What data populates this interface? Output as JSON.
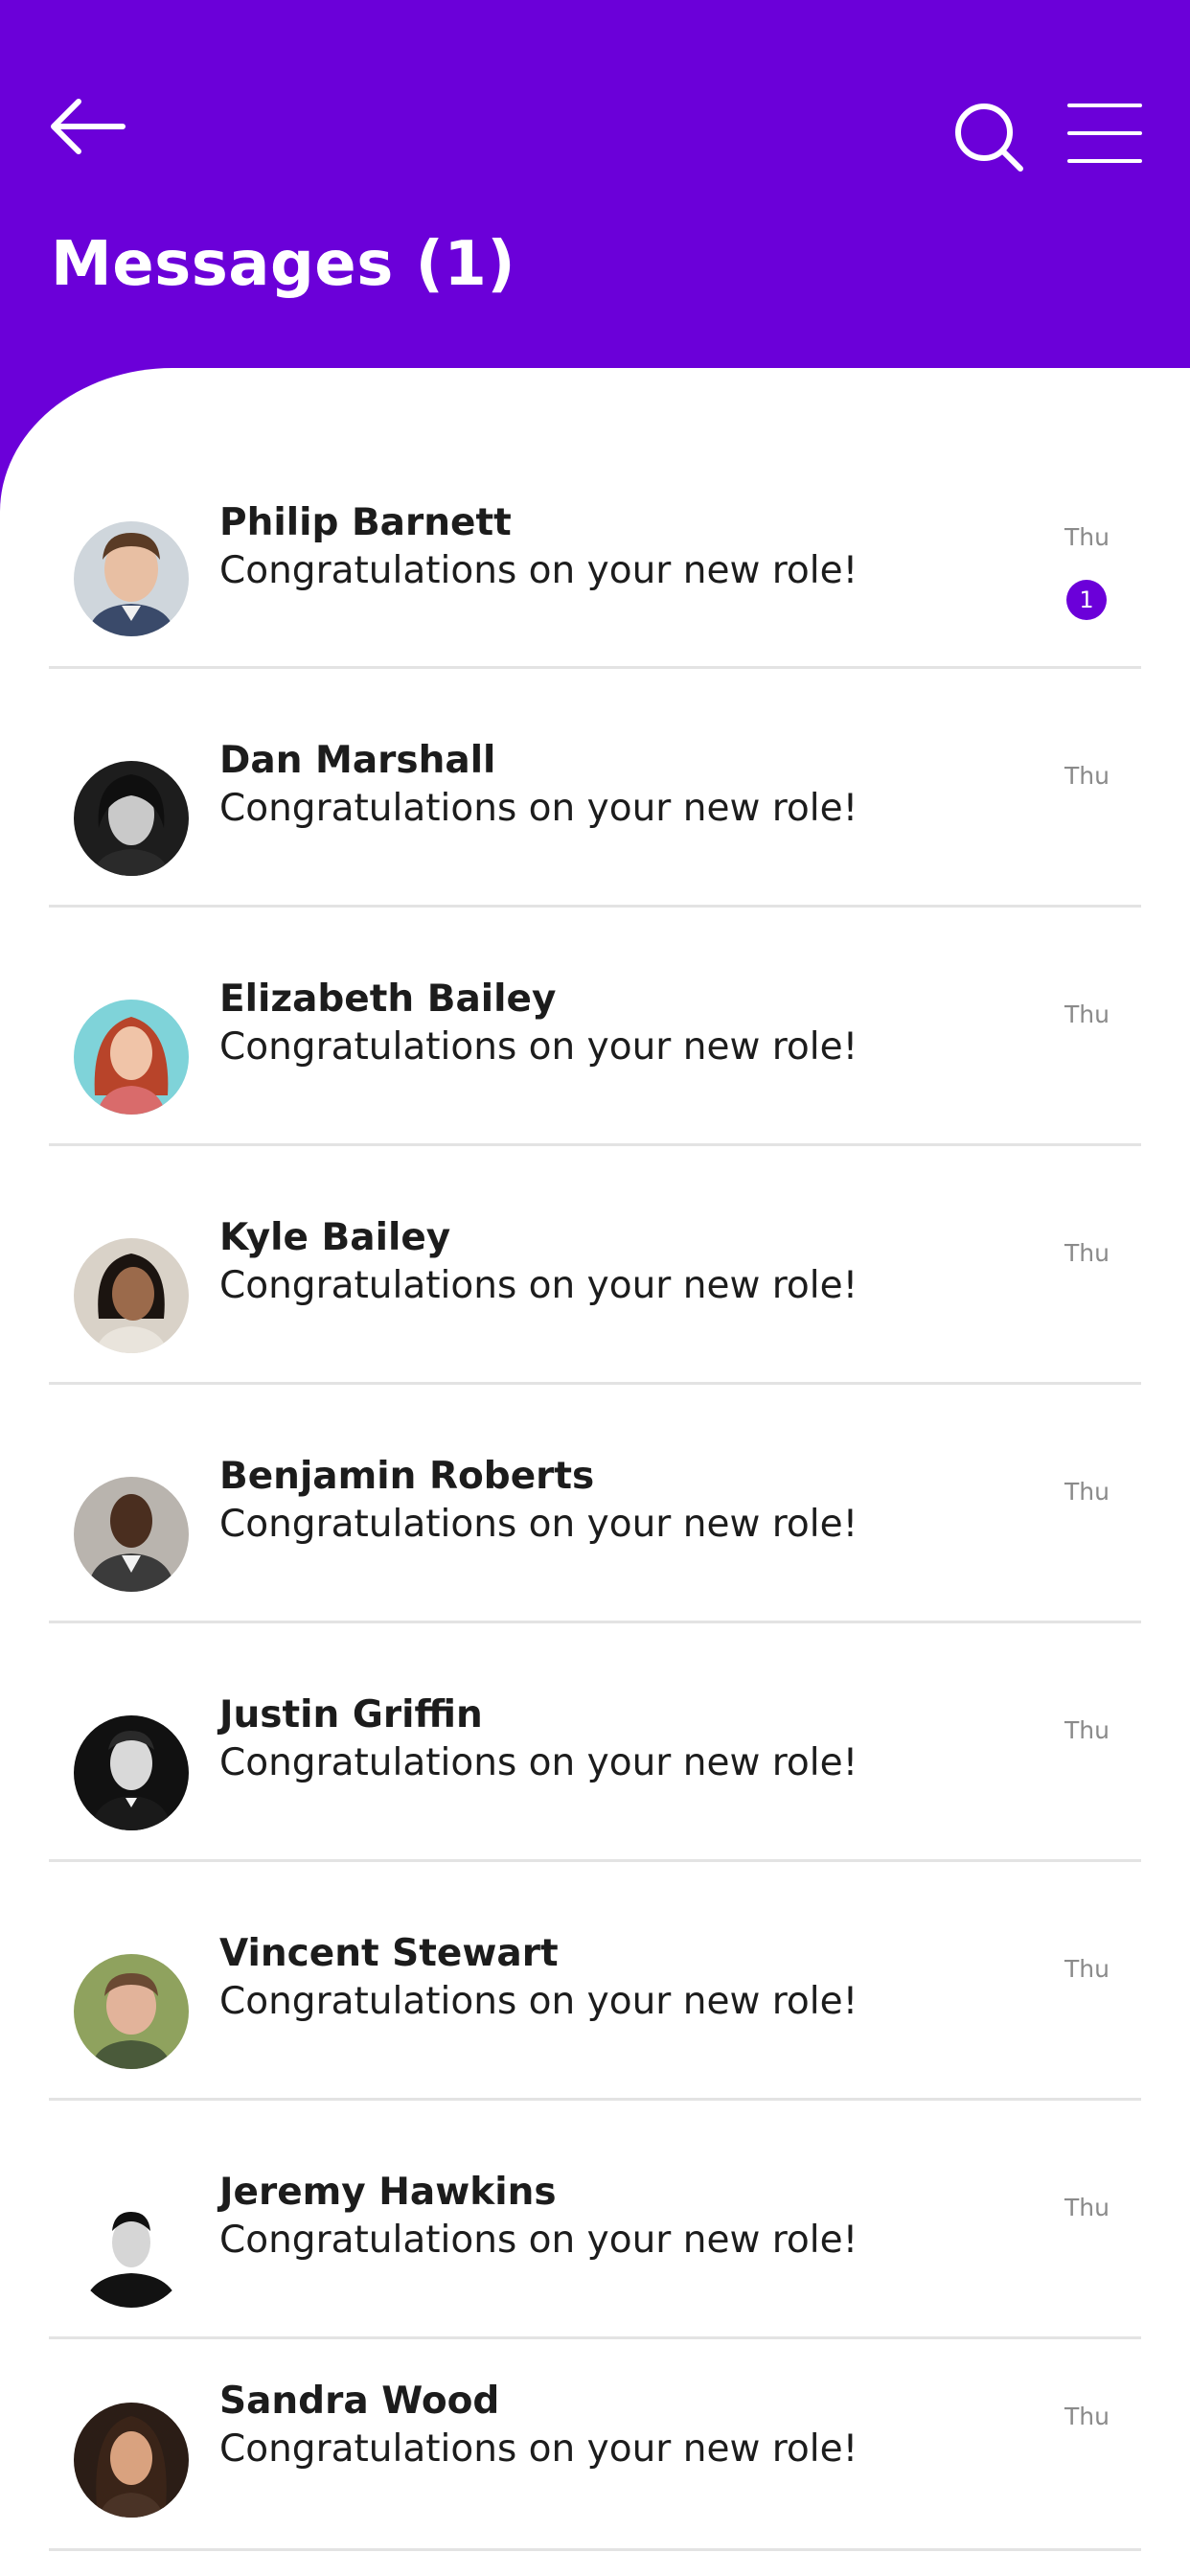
{
  "header": {
    "title": "Messages (1)",
    "background_color": "#6b00d9",
    "icons": [
      "arrow-left-icon",
      "search-icon",
      "hamburger-menu-icon"
    ]
  },
  "conversations": [
    {
      "name": "Philip Barnett",
      "message": "Congratulations on your new role!",
      "time": "Thu",
      "unread": "1"
    },
    {
      "name": "Dan Marshall",
      "message": "Congratulations on your new role!",
      "time": "Thu"
    },
    {
      "name": "Elizabeth Bailey",
      "message": "Congratulations on your new role!",
      "time": "Thu"
    },
    {
      "name": "Kyle Bailey",
      "message": "Congratulations on your new role!",
      "time": "Thu"
    },
    {
      "name": "Benjamin Roberts",
      "message": "Congratulations on your new role!",
      "time": "Thu"
    },
    {
      "name": "Justin Griffin",
      "message": "Congratulations on your new role!",
      "time": "Thu"
    },
    {
      "name": "Vincent Stewart",
      "message": "Congratulations on your new role!",
      "time": "Thu"
    },
    {
      "name": "Jeremy Hawkins",
      "message": "Congratulations on your new role!",
      "time": "Thu"
    },
    {
      "name": "Sandra Wood",
      "message": "Congratulations on your new role!",
      "time": "Thu"
    }
  ],
  "colors": {
    "accent": "#6b00d9",
    "divider": "#e3e3e3",
    "timestamp": "#8a8a8a"
  }
}
